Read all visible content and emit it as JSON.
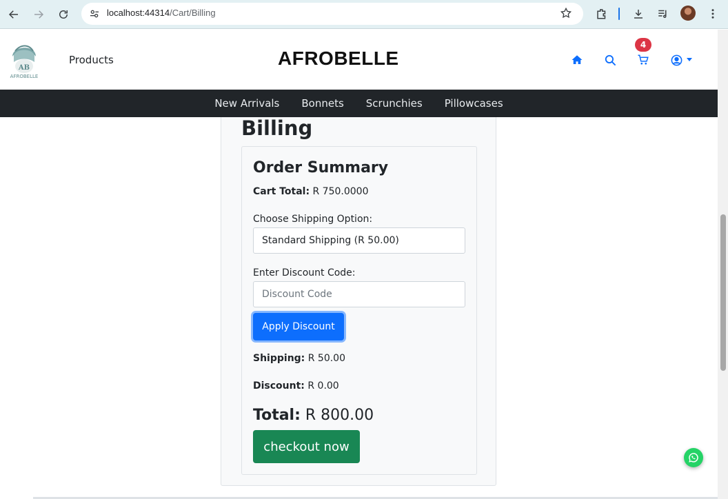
{
  "browser": {
    "url_host": "localhost:44314",
    "url_path": "/Cart/Billing"
  },
  "header": {
    "logo_text": "AB AFROBELLE",
    "products_label": "Products",
    "brand": "AFROBELLE",
    "cart_count": "4"
  },
  "nav": {
    "items": [
      {
        "label": "New Arrivals"
      },
      {
        "label": "Bonnets"
      },
      {
        "label": "Scrunchies"
      },
      {
        "label": "Pillowcases"
      }
    ]
  },
  "billing": {
    "title": "Billing",
    "summary_title": "Order Summary",
    "cart_total_label": "Cart Total:",
    "cart_total_value": " R 750.0000",
    "shipping_option_label": "Choose Shipping Option:",
    "shipping_option_selected": "Standard Shipping (R 50.00)",
    "discount_label": "Enter Discount Code:",
    "discount_placeholder": "Discount Code",
    "apply_label": "Apply Discount",
    "shipping_label": "Shipping:",
    "shipping_value": " R 50.00",
    "discount_amount_label": "Discount:",
    "discount_amount_value": " R 0.00",
    "total_label": "Total:",
    "total_value": " R 800.00",
    "checkout_label": "checkout now"
  },
  "colors": {
    "primary": "#0d6efd",
    "success": "#198754",
    "badge": "#dc3545",
    "navbar": "#212529"
  }
}
